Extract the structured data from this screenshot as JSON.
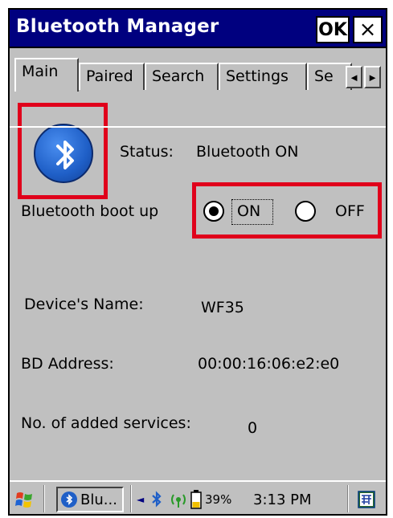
{
  "window": {
    "title": "Bluetooth Manager",
    "ok_label": "OK",
    "close_label": "×"
  },
  "tabs": [
    {
      "label": "Main"
    },
    {
      "label": "Paired"
    },
    {
      "label": "Search"
    },
    {
      "label": "Settings"
    },
    {
      "label": "Se"
    }
  ],
  "tab_scroll": {
    "left": "◄",
    "right": "►"
  },
  "main": {
    "status_label": "Status:",
    "status_value": "Bluetooth ON",
    "boot_label": "Bluetooth boot up",
    "boot_options": [
      {
        "label": "ON",
        "selected": true
      },
      {
        "label": "OFF",
        "selected": false
      }
    ],
    "device_name_label": "Device's Name:",
    "device_name_value": "WF35",
    "bd_address_label": "BD Address:",
    "bd_address_value": "00:00:16:06:e2:e0",
    "services_label": "No. of added services:",
    "services_value": "0"
  },
  "taskbar": {
    "task_label": "Blu...",
    "battery": "39%",
    "time": "3:13 PM"
  },
  "icons": [
    "windows-start-icon",
    "bluetooth-icon",
    "bluetooth-tray-icon",
    "signal-icon",
    "battery-icon",
    "keyboard-icon"
  ],
  "colors": {
    "titlebar": "#00007f",
    "window": "#c0c0c0",
    "highlight": "#e0001b",
    "bluetooth": "#1f5fc7"
  }
}
